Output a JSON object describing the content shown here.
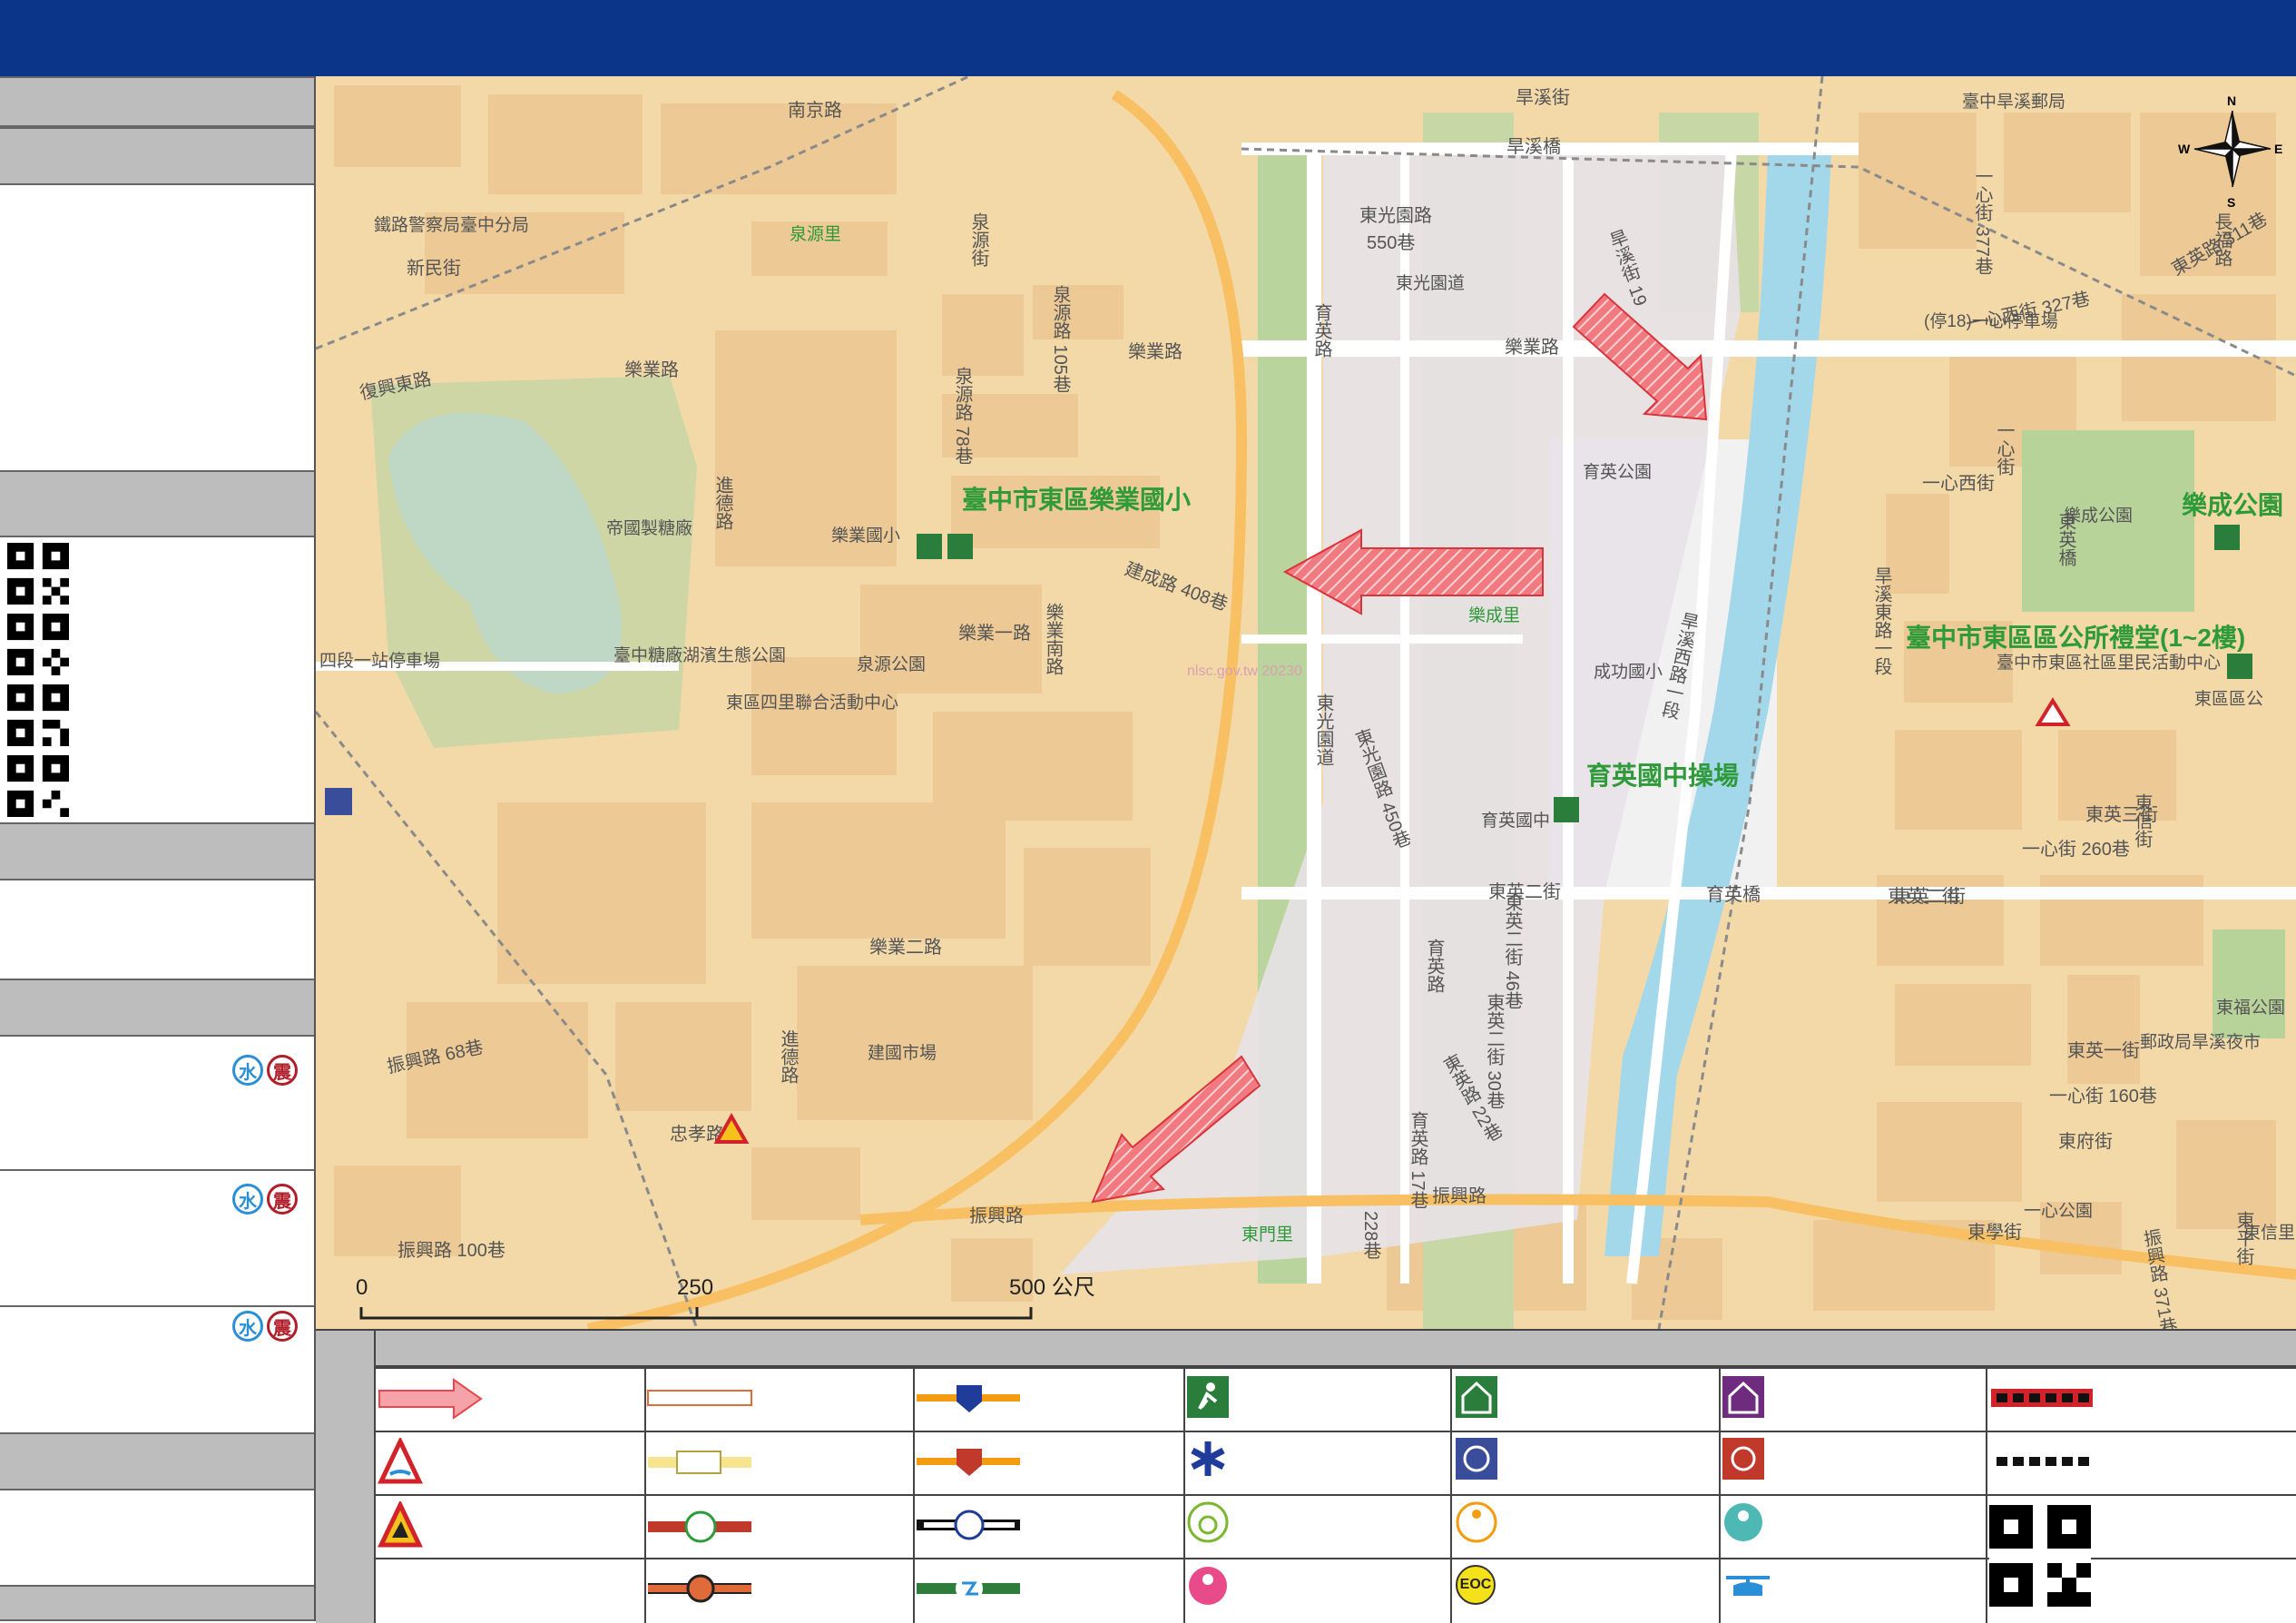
{
  "colors": {
    "header": "#0a3589",
    "panel_gray": "#bdbdbd",
    "map_land": "#f3d9a8",
    "map_block": "#ecc995",
    "river": "#a3d7ea",
    "park": "#b8d39a",
    "evac_arrow": "#e8474f",
    "poi_label": "#2f9a3a"
  },
  "sidebar": {
    "hazards": [
      {
        "water_icon": "水",
        "quake_icon": "震"
      },
      {
        "water_icon": "水",
        "quake_icon": "震"
      },
      {
        "water_icon": "水",
        "quake_icon": "震"
      }
    ]
  },
  "map": {
    "streets": {
      "s1": "東光園路",
      "s1b": "550巷",
      "s2": "東光園道",
      "s3": "樂業路",
      "s3b": "樂業路",
      "s3c": "樂業路",
      "s4": "樂業一路",
      "s5": "樂業二路",
      "s6": "進德路",
      "s6b": "進德路",
      "s7": "建成路 408巷",
      "s8": "樂業南路",
      "s9": "旱溪街 19",
      "s10": "旱溪西路一段",
      "s11": "東英二街",
      "s12": "東英二街",
      "s13": "育英路",
      "s13b": "育英路",
      "s14": "東光園路 450巷",
      "s15": "東英二街 46巷",
      "s16": "東英二街 30巷",
      "s17": "育英路 17巷",
      "s18": "東英路 22巷",
      "s19": "振興路",
      "s19b": "振興路",
      "s20": "忠孝路",
      "s21": "旱溪橋",
      "s22": "育英橋",
      "s23": "東英橋",
      "s24": "南京路",
      "s25": "新民街",
      "s26": "振興路 100巷",
      "s27": "振興路 68巷",
      "s28": "復興東路",
      "s29": "一心西街",
      "s30": "一心街 260巷",
      "s31": "東英一街",
      "s32": "一心街 160巷",
      "s33": "東英二街",
      "s34": "東府街",
      "s35": "東學街",
      "s36": "東平街",
      "s37": "旱溪東路一段",
      "s38": "一心街",
      "s39": "長福路",
      "s40": "東信街",
      "s41": "東英三街",
      "s42": "旱溪街",
      "s43": "泉源街",
      "s44": "泉源路 105巷",
      "s45": "泉源路 78巷",
      "s46": "228巷",
      "s47": "一心街 377巷",
      "s48": "東英路 311巷",
      "s49": "一心西街 327巷",
      "s50": "振興路 371巷"
    },
    "pois": {
      "p1": "臺中市東區樂業國小",
      "p2": "臺中市東區區公所禮堂(1~2樓)",
      "p3": "育英國中操場",
      "p4": "樂成公園",
      "p5": "樂業國小",
      "p6": "帝國製糖廠",
      "p7": "臺中糖廠湖濱生態公園",
      "p8": "泉源公園",
      "p9": "東區四里聯合活動中心",
      "p10": "育英公園",
      "p11": "成功國小",
      "p12": "育英國中",
      "p13": "樂成公園",
      "p14": "建國市場",
      "p15": "臺中市東區社區里民活動中心",
      "p16": "東區區公",
      "p17": "東福公園",
      "p18": "一心公園",
      "p19": "臺中旱溪郵局",
      "p20": "鐵路警察局臺中分局",
      "p21": "(停18)一心停車場",
      "p22": "郵政局旱溪夜市",
      "p23": "四段一站停車場",
      "p24": "東門里",
      "p25": "樂成里",
      "p26": "泉源里",
      "p27": "東信里",
      "p28": "東光園道"
    },
    "compass": {
      "n": "N",
      "s": "S",
      "e": "E",
      "w": "W"
    },
    "scale": {
      "t0": "0",
      "t1": "250",
      "t2": "500 公尺"
    },
    "watermark": "nlsc.gov.tw 20230"
  },
  "legend": {
    "eoc": "EOC"
  }
}
